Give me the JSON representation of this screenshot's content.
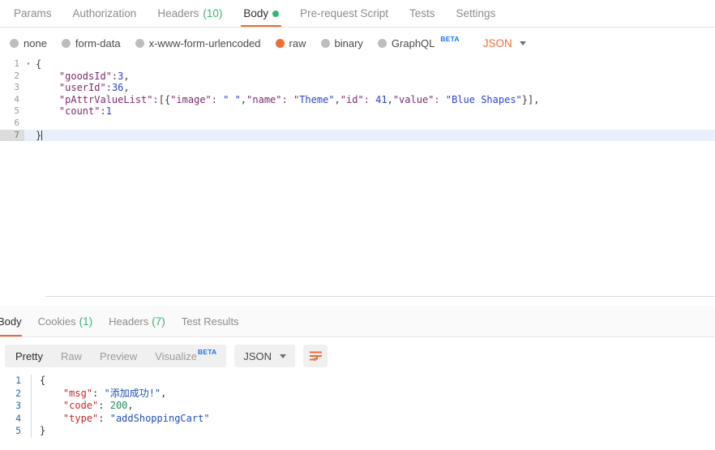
{
  "request": {
    "tabs": [
      {
        "label": "Params",
        "count": null,
        "active": false,
        "dot": false
      },
      {
        "label": "Authorization",
        "count": null,
        "active": false,
        "dot": false
      },
      {
        "label": "Headers",
        "count": "(10)",
        "active": false,
        "dot": false
      },
      {
        "label": "Body",
        "count": null,
        "active": true,
        "dot": true
      },
      {
        "label": "Pre-request Script",
        "count": null,
        "active": false,
        "dot": false
      },
      {
        "label": "Tests",
        "count": null,
        "active": false,
        "dot": false
      },
      {
        "label": "Settings",
        "count": null,
        "active": false,
        "dot": false
      }
    ],
    "body_types": [
      {
        "label": "none",
        "selected": false,
        "beta": false
      },
      {
        "label": "form-data",
        "selected": false,
        "beta": false
      },
      {
        "label": "x-www-form-urlencoded",
        "selected": false,
        "beta": false
      },
      {
        "label": "raw",
        "selected": true,
        "beta": false
      },
      {
        "label": "binary",
        "selected": false,
        "beta": false
      },
      {
        "label": "GraphQL",
        "selected": false,
        "beta": true,
        "beta_label": "BETA"
      }
    ],
    "language": "JSON",
    "editor": {
      "lines": [
        {
          "num": "1",
          "fold": "▾",
          "text": "{",
          "active": false
        },
        {
          "num": "2",
          "fold": "",
          "text": "    \"goodsId\":3,",
          "active": false
        },
        {
          "num": "3",
          "fold": "",
          "text": "    \"userId\":36,",
          "active": false
        },
        {
          "num": "4",
          "fold": "",
          "text": "    \"pAttrValueList\":[{\"image\": \" \",\"name\": \"Theme\",\"id\": 41,\"value\": \"Blue Shapes\"}],",
          "active": false
        },
        {
          "num": "5",
          "fold": "",
          "text": "    \"count\":1",
          "active": false
        },
        {
          "num": "6",
          "fold": "",
          "text": "",
          "active": false
        },
        {
          "num": "7",
          "fold": "",
          "text": "}",
          "active": true
        }
      ]
    }
  },
  "response": {
    "tabs": [
      {
        "label": "Body",
        "count": null,
        "active": true
      },
      {
        "label": "Cookies",
        "count": "(1)",
        "active": false
      },
      {
        "label": "Headers",
        "count": "(7)",
        "active": false
      },
      {
        "label": "Test Results",
        "count": null,
        "active": false
      }
    ],
    "view_modes": [
      {
        "label": "Pretty",
        "active": true,
        "beta": false
      },
      {
        "label": "Raw",
        "active": false,
        "beta": false
      },
      {
        "label": "Preview",
        "active": false,
        "beta": false
      },
      {
        "label": "Visualize",
        "active": false,
        "beta": true,
        "beta_label": "BETA"
      }
    ],
    "format": "JSON",
    "wrap_icon": "word-wrap-icon",
    "body": {
      "lines": [
        {
          "num": "1",
          "segments": [
            {
              "text": "{",
              "type": "brace"
            }
          ]
        },
        {
          "num": "2",
          "segments": [
            {
              "text": "    ",
              "type": "punc"
            },
            {
              "text": "\"msg\"",
              "type": "key"
            },
            {
              "text": ": ",
              "type": "punc"
            },
            {
              "text": "\"添加成功!\"",
              "type": "strv"
            },
            {
              "text": ",",
              "type": "punc"
            }
          ]
        },
        {
          "num": "3",
          "segments": [
            {
              "text": "    ",
              "type": "punc"
            },
            {
              "text": "\"code\"",
              "type": "key"
            },
            {
              "text": ": ",
              "type": "punc"
            },
            {
              "text": "200",
              "type": "numv"
            },
            {
              "text": ",",
              "type": "punc"
            }
          ]
        },
        {
          "num": "4",
          "segments": [
            {
              "text": "    ",
              "type": "punc"
            },
            {
              "text": "\"type\"",
              "type": "key"
            },
            {
              "text": ": ",
              "type": "punc"
            },
            {
              "text": "\"addShoppingCart\"",
              "type": "strv"
            }
          ]
        },
        {
          "num": "5",
          "segments": [
            {
              "text": "}",
              "type": "brace"
            }
          ]
        }
      ]
    }
  },
  "colors": {
    "accent_orange": "#ef6c35",
    "green_count": "#3bb273",
    "status_dot_green": "#2eb67d",
    "beta_blue": "#1a73e8",
    "active_line_blue": "#e8f0fb",
    "resp_key_red": "#c7272c",
    "resp_string_blue": "#1f50b5",
    "resp_number_green": "#1f8a5f"
  }
}
